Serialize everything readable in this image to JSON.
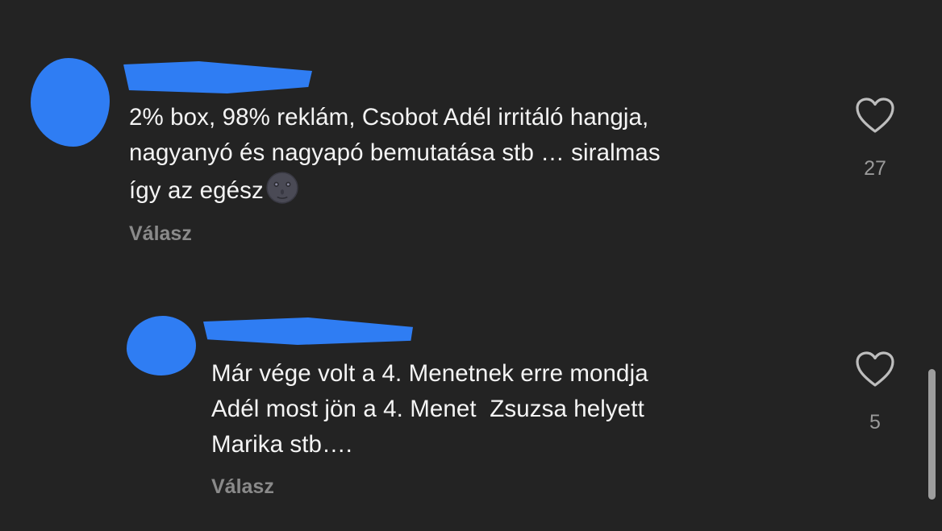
{
  "comments": [
    {
      "text": "2% box, 98% reklám, Csobot Adél irritáló hangja,\nnagyanyó és nagyapó bemutatása stb … siralmas\nígy az egész",
      "emoji_icon": "new-moon-face-icon",
      "reply_label": "Válasz",
      "likes": "27",
      "heart_icon": "heart-outline-icon"
    },
    {
      "text": "Már vége volt a 4. Menetnek erre mondja\nAdél most jön a 4. Menet  Zsuzsa helyett\nMarika stb….",
      "reply_label": "Válasz",
      "likes": "5",
      "heart_icon": "heart-outline-icon"
    }
  ],
  "colors": {
    "background": "#232323",
    "redaction": "#2f7df3",
    "text": "#f4f4f4",
    "muted": "#8a8a8a"
  }
}
